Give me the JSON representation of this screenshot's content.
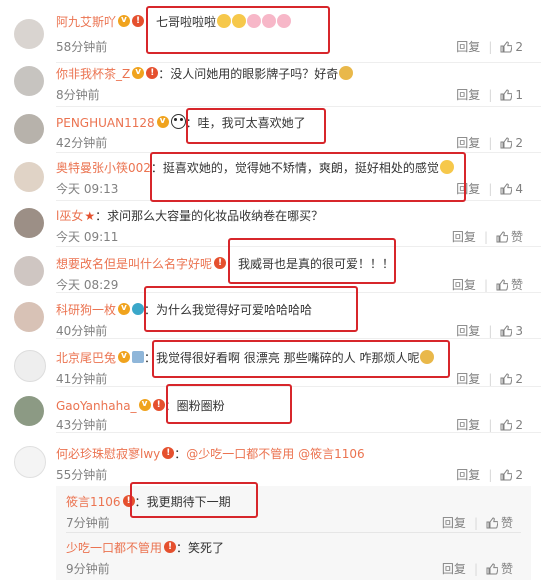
{
  "comments": [
    {
      "user": "阿九艾斯吖",
      "text": "七哥啦啦啦",
      "time": "58分钟前",
      "reply": "回复",
      "likes": "2"
    },
    {
      "user": "你非我杯茶_Z",
      "text": "没人问她用的眼影牌子吗？好奇",
      "time": "8分钟前",
      "reply": "回复",
      "likes": "1"
    },
    {
      "user": "PENGHUAN1128",
      "text": "哇，我可太喜欢她了",
      "time": "42分钟前",
      "reply": "回复",
      "likes": "2"
    },
    {
      "user": "奥特曼张小筷002",
      "text": "挺喜欢她的，觉得她不矫情，爽朗，挺好相处的感觉",
      "time": "今天 09:13",
      "reply": "回复",
      "likes": "4"
    },
    {
      "user": "l巫女",
      "text": "求问那么大容量的化妆品收纳卷在哪买？",
      "time": "今天 09:11",
      "reply": "回复",
      "likes": "赞"
    },
    {
      "user": "想要改名但是叫什么名字好呢",
      "text": "我威哥也是真的很可爱！！！",
      "time": "今天 08:29",
      "reply": "回复",
      "likes": "赞"
    },
    {
      "user": "科研狗一枚",
      "text": "为什么我觉得好可爱哈哈哈哈",
      "time": "40分钟前",
      "reply": "回复",
      "likes": "3"
    },
    {
      "user": "北京尾巴兔",
      "text": "我觉得很好看啊 很漂亮 那些嘴碎的人 咋那烦人呢",
      "time": "41分钟前",
      "reply": "回复",
      "likes": "2"
    },
    {
      "user": "GaoYanhaha_",
      "text": "圈粉圈粉",
      "time": "43分钟前",
      "reply": "回复",
      "likes": "2"
    },
    {
      "user": "何必珍珠慰寂寥lwy",
      "mention1": "@少吃一口都不管用",
      "mention2": "@筱言1106",
      "time": "55分钟前",
      "reply": "回复",
      "likes": "2"
    }
  ],
  "subcomments": [
    {
      "user": "筱言1106",
      "text": "我更期待下一期",
      "time": "7分钟前",
      "reply": "回复",
      "likes": "赞"
    },
    {
      "user": "少吃一口都不管用",
      "text": "笑死了",
      "time": "9分钟前",
      "reply": "回复",
      "likes": "赞"
    }
  ],
  "colors": {
    "username": "#eb7350",
    "highlight_box": "#d7262b",
    "muted": "#808080"
  }
}
